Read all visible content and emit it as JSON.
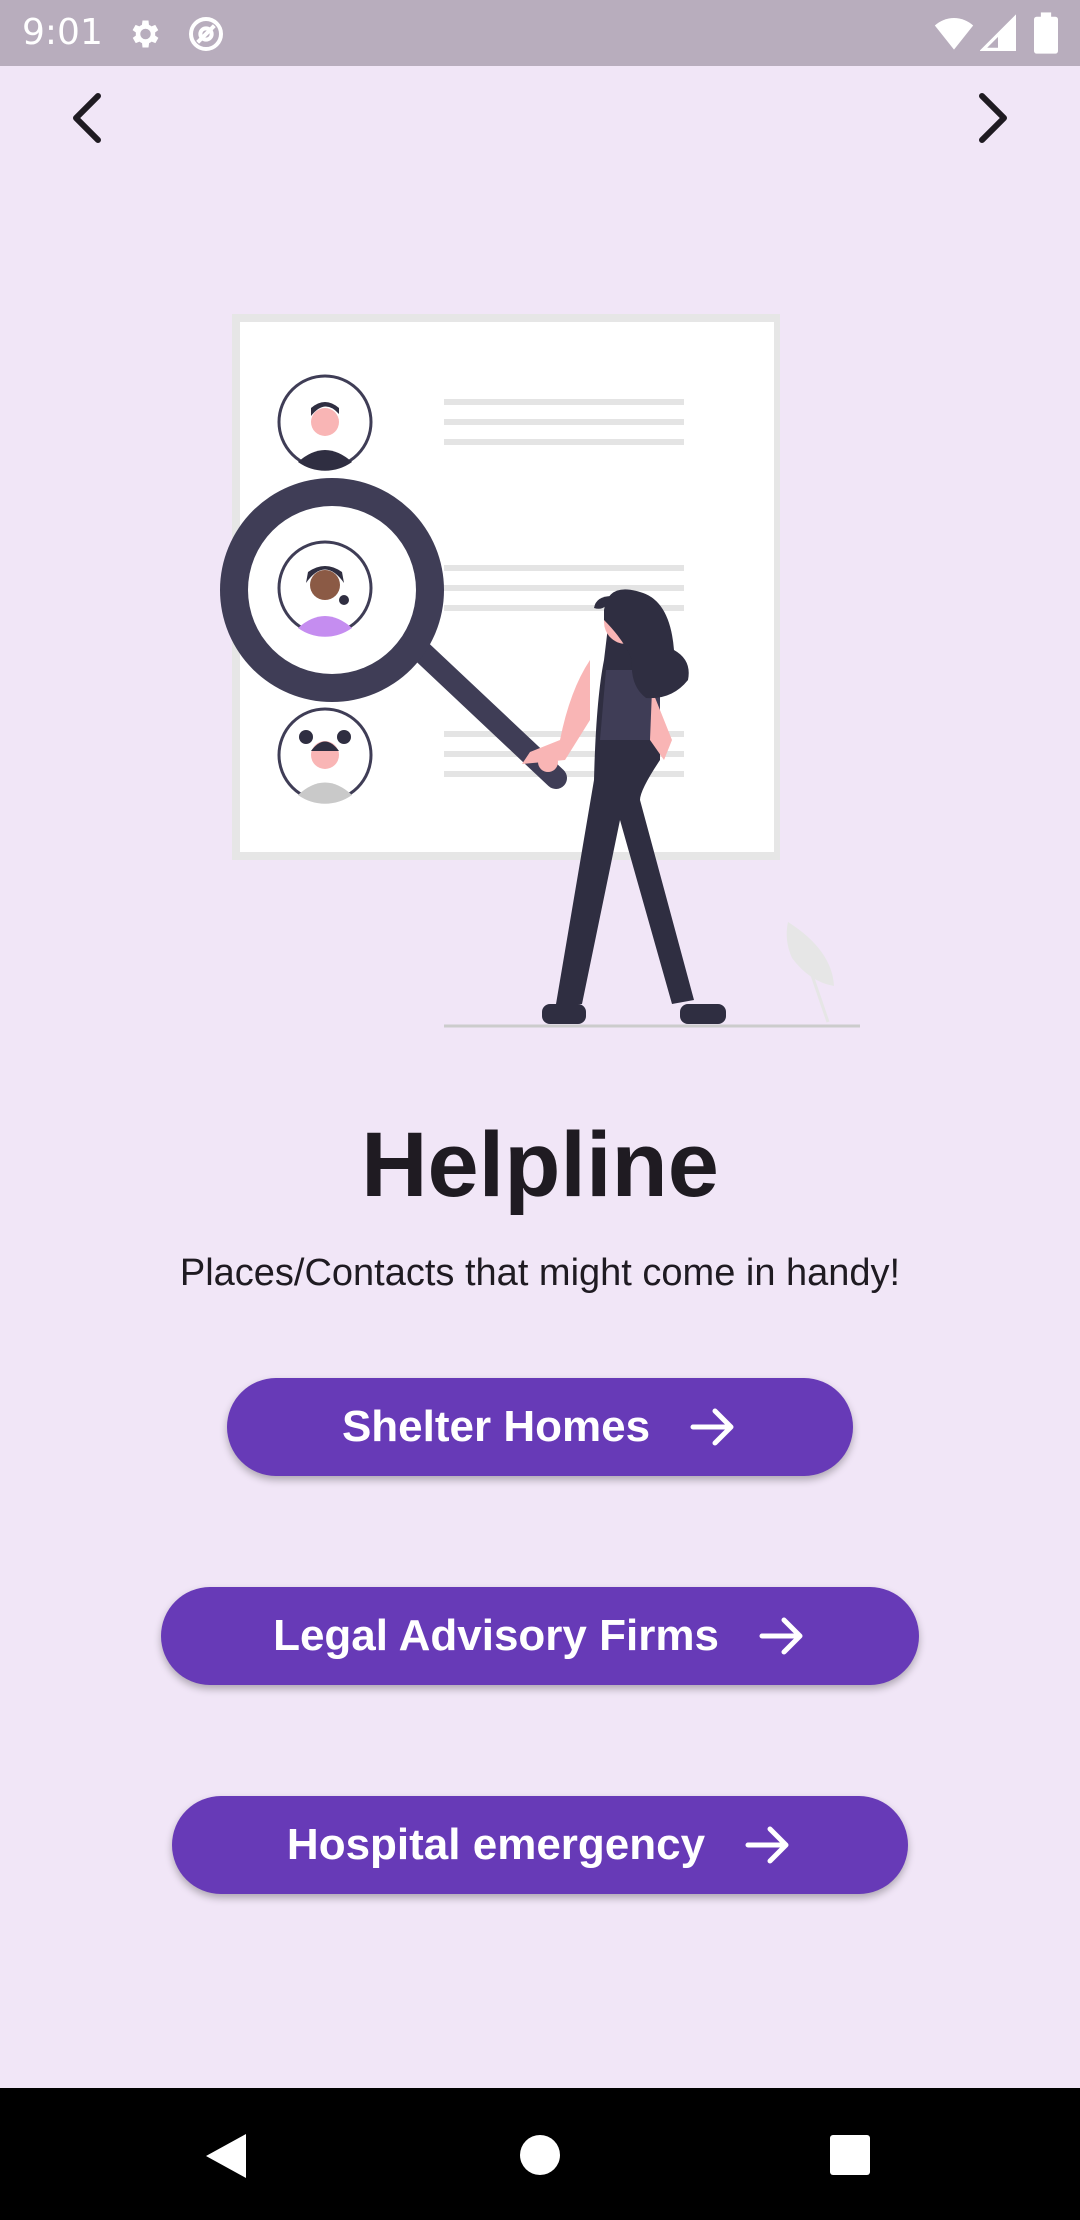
{
  "status_bar": {
    "time": "9:01",
    "icons": [
      "settings-icon",
      "at-sign-icon",
      "wifi-icon",
      "signal-icon",
      "battery-icon"
    ]
  },
  "top_nav": {
    "back_icon": "chevron-left-icon",
    "forward_icon": "chevron-right-icon"
  },
  "illustration": {
    "description_icon": "helpline-search-illustration"
  },
  "content": {
    "title": "Helpline",
    "subtitle": "Places/Contacts that might come in handy!"
  },
  "buttons": [
    {
      "label": "Shelter Homes",
      "icon": "arrow-right-icon"
    },
    {
      "label": "Legal Advisory Firms",
      "icon": "arrow-right-icon"
    },
    {
      "label": "Hospital emergency",
      "icon": "arrow-right-icon"
    }
  ],
  "system_nav": {
    "icons": [
      "back-triangle-icon",
      "home-circle-icon",
      "recents-square-icon"
    ]
  },
  "colors": {
    "background": "#f1e6f7",
    "accent": "#673ab7",
    "status_bar": "#b8adbd",
    "text": "#1f1b22"
  }
}
